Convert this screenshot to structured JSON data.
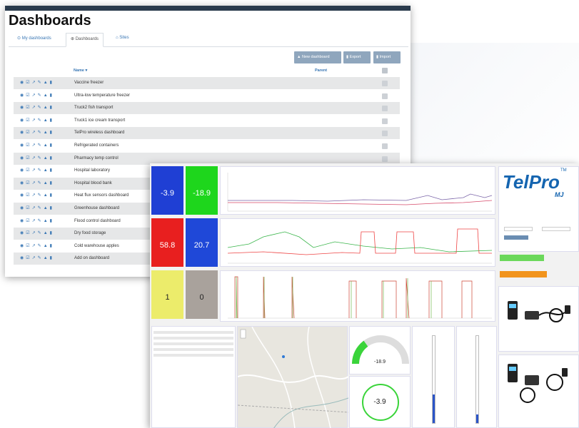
{
  "app": {
    "title": "Dashboards"
  },
  "tabs": [
    {
      "label": "My dashboards",
      "icon": "user-circle-icon"
    },
    {
      "label": "Dashboards",
      "icon": "globe-icon"
    },
    {
      "label": "Sites",
      "icon": "home-icon"
    }
  ],
  "toolbar": {
    "new_label": "New dashboard",
    "export_label": "Export",
    "import_label": "Import"
  },
  "table": {
    "headers": {
      "name": "Name",
      "parent": "Parent"
    },
    "rows": [
      "Vaccine freezer",
      "Ultra-low temperature freezer",
      "Truck2 fish transport",
      "Truck1 ice cream transport",
      "TelPro wireless dashboard",
      "Refrigerated containers",
      "Pharmacy temp control",
      "Hospital laboratory",
      "Hospital blood bank",
      "Heat flux sensors dashboard",
      "Greenhouse dashboard",
      "Flood control dashboard",
      "Dry food storage",
      "Cold warehouse apples",
      "Add on dashboard"
    ]
  },
  "tiles": [
    {
      "value": "-3.9",
      "color": "#1f3fd4"
    },
    {
      "value": "-18.9",
      "color": "#1ed61c"
    },
    {
      "value": "58.8",
      "color": "#e81f1f"
    },
    {
      "value": "20.7",
      "color": "#1f48d8"
    },
    {
      "value": "1",
      "color": "#ecec6b"
    },
    {
      "value": "0",
      "color": "#a9a29c"
    }
  ],
  "logo": {
    "text": "TelPro",
    "sub": "MJ",
    "tm": "TM"
  },
  "gauge": {
    "value": "-18.9",
    "fill": 0.3
  },
  "circle": {
    "value": "-3.9"
  },
  "thermo": [
    {
      "fill": 0.33
    },
    {
      "fill": 0.1
    }
  ],
  "colors": {
    "accent": "#3876b4",
    "button": "#8fa6bd",
    "green": "#1ed61c",
    "orange": "#f2941d"
  }
}
